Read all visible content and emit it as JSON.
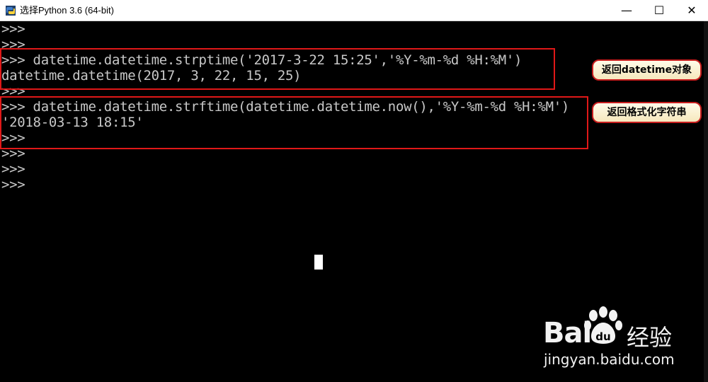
{
  "window": {
    "title": "选择Python 3.6 (64-bit)",
    "minimize": "—",
    "maximize": "☐",
    "close": "✕"
  },
  "console": {
    "lines": [
      ">>>",
      ">>>",
      ">>> datetime.datetime.strptime('2017-3-22 15:25','%Y-%m-%d %H:%M')",
      "datetime.datetime(2017, 3, 22, 15, 25)",
      ">>>",
      ">>> datetime.datetime.strftime(datetime.datetime.now(),'%Y-%m-%d %H:%M')",
      "'2018-03-13 18:15'",
      ">>>",
      ">>>",
      ">>>",
      ">>>"
    ]
  },
  "annotations": {
    "first": "返回datetime对象",
    "second": "返回格式化字符串"
  },
  "watermark": {
    "brand_left": "Bai",
    "brand_right": "经验",
    "url": "jingyan.baidu.com"
  },
  "colors": {
    "highlight_border": "#e01818",
    "callout_fill": "#fff6d8"
  }
}
